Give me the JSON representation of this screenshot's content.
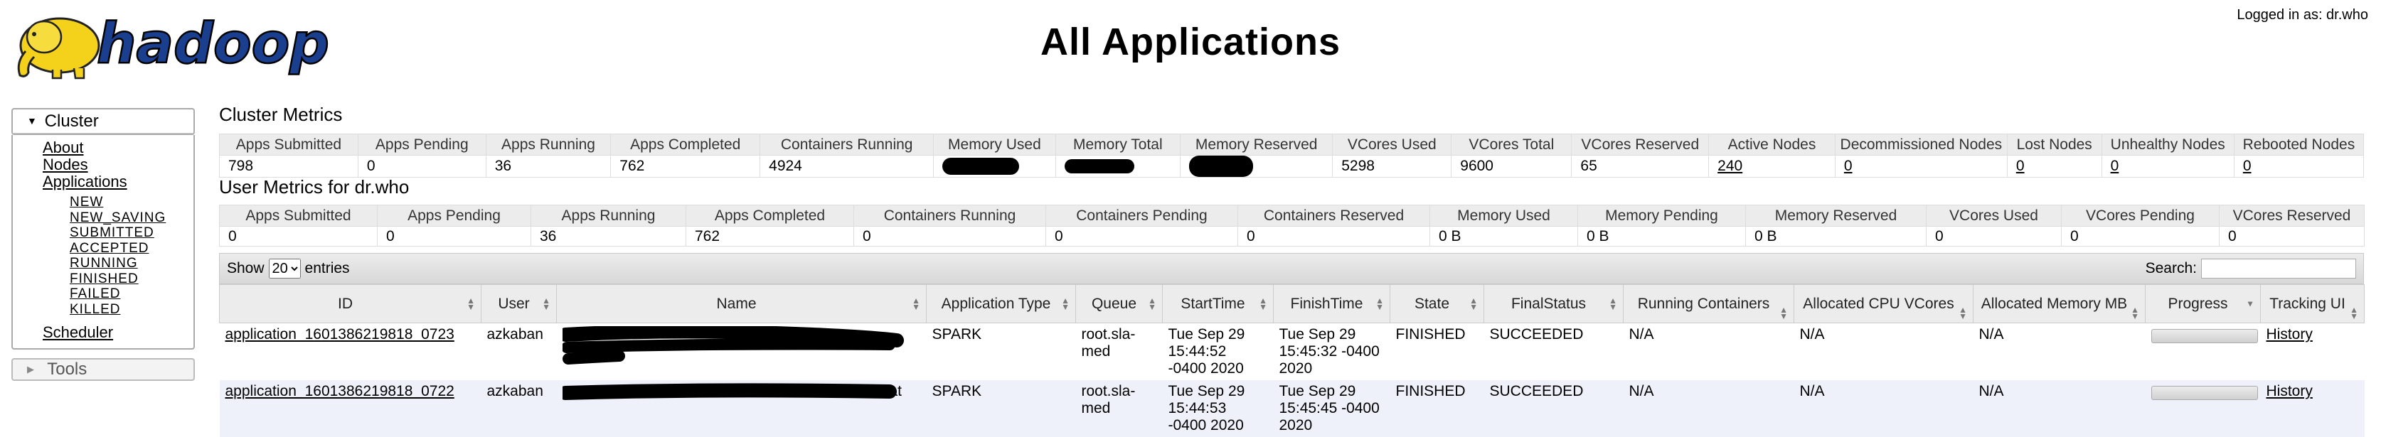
{
  "header": {
    "logo_text": "hadoop",
    "title": "All Applications",
    "login_text": "Logged in as: dr.who"
  },
  "nav": {
    "cluster_label": "Cluster",
    "links": [
      "About",
      "Nodes",
      "Applications"
    ],
    "sub_links": [
      "NEW",
      "NEW_SAVING",
      "SUBMITTED",
      "ACCEPTED",
      "RUNNING",
      "FINISHED",
      "FAILED",
      "KILLED"
    ],
    "scheduler": "Scheduler",
    "tools_label": "Tools"
  },
  "cluster_metrics": {
    "title": "Cluster Metrics",
    "headers": [
      "Apps Submitted",
      "Apps Pending",
      "Apps Running",
      "Apps Completed",
      "Containers Running",
      "Memory Used",
      "Memory Total",
      "Memory Reserved",
      "VCores Used",
      "VCores Total",
      "VCores Reserved",
      "Active Nodes",
      "Decommissioned Nodes",
      "Lost Nodes",
      "Unhealthy Nodes",
      "Rebooted Nodes"
    ],
    "values": [
      "798",
      "0",
      "36",
      "762",
      "4924",
      "",
      "",
      "",
      "5298",
      "9600",
      "65",
      "240",
      "0",
      "0",
      "0",
      "0"
    ]
  },
  "user_metrics": {
    "title": "User Metrics for dr.who",
    "headers": [
      "Apps Submitted",
      "Apps Pending",
      "Apps Running",
      "Apps Completed",
      "Containers Running",
      "Containers Pending",
      "Containers Reserved",
      "Memory Used",
      "Memory Pending",
      "Memory Reserved",
      "VCores Used",
      "VCores Pending",
      "VCores Reserved"
    ],
    "values": [
      "0",
      "0",
      "36",
      "762",
      "0",
      "0",
      "0",
      "0 B",
      "0 B",
      "0 B",
      "0",
      "0",
      "0"
    ]
  },
  "apps": {
    "show_label": "Show",
    "entries_value": "20",
    "entries_label": "entries",
    "search_label": "Search:",
    "columns": [
      "ID",
      "User",
      "Name",
      "Application Type",
      "Queue",
      "StartTime",
      "FinishTime",
      "State",
      "FinalStatus",
      "Running Containers",
      "Allocated CPU VCores",
      "Allocated Memory MB",
      "Progress",
      "Tracking UI"
    ],
    "rows": [
      {
        "id": "application_1601386219818_0723",
        "user": "azkaban",
        "name": "",
        "type": "SPARK",
        "queue": "root.sla-med",
        "start": "Tue Sep 29 15:44:52 -0400 2020",
        "finish": "Tue Sep 29 15:45:32 -0400 2020",
        "state": "FINISHED",
        "final": "SUCCEEDED",
        "running": "N/A",
        "cpu": "N/A",
        "mem": "N/A",
        "progress": 1.0,
        "tracking": "History"
      },
      {
        "id": "application_1601386219818_0722",
        "user": "azkaban",
        "name": "at",
        "type": "SPARK",
        "queue": "root.sla-med",
        "start": "Tue Sep 29 15:44:53 -0400 2020",
        "finish": "Tue Sep 29 15:45:45 -0400 2020",
        "state": "FINISHED",
        "final": "SUCCEEDED",
        "running": "N/A",
        "cpu": "N/A",
        "mem": "N/A",
        "progress": 1.0,
        "tracking": "History"
      }
    ]
  }
}
